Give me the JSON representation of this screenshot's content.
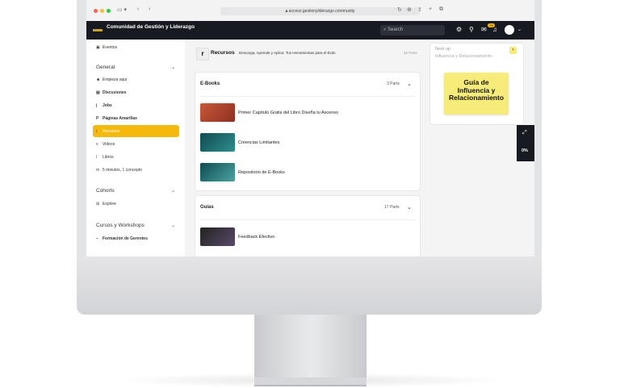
{
  "browser": {
    "url": "acceso.gestionyliderazgo.community",
    "traffic_lights": [
      "#ff5f57",
      "#febc2e",
      "#28c840"
    ]
  },
  "header": {
    "community_name": "Comunidad de Gestión y Liderazgo",
    "search_placeholder": "Search",
    "notification_badge": "+9"
  },
  "sidebar": {
    "top_item": "Eventos",
    "general_heading": "General",
    "general_items": [
      {
        "label": "Empieza aquí",
        "icon": "person-icon"
      },
      {
        "label": "Discusiones",
        "icon": "chat-icon"
      },
      {
        "label": "Jobs",
        "icon": "j"
      },
      {
        "label": "Páginas Amarillas",
        "icon": "P"
      },
      {
        "label": "Recursos",
        "icon": "r"
      },
      {
        "label": "Videos",
        "icon": "v"
      },
      {
        "label": "Libros",
        "icon": "l"
      },
      {
        "label": "5 minutos, 1 concepto",
        "icon": "m"
      }
    ],
    "cohorts_heading": "Cohorts",
    "cohorts_items": [
      {
        "label": "Explore",
        "icon": "grid-icon"
      }
    ],
    "cursos_heading": "Cursos y Workshops",
    "cursos_items": [
      {
        "label": "Formación de Gerentes",
        "icon": "dash"
      }
    ]
  },
  "main": {
    "title": "Recursos",
    "subtitle": "Descarga, Aprende y Aplica: Tus Herramientas para el Éxito",
    "parts": "32 Parts",
    "sections": [
      {
        "title": "E-Books",
        "parts": "3 Parts",
        "items": [
          {
            "label": "Primer Capítulo Gratis del Libro Diseña tu Ascenso"
          },
          {
            "label": "Creencias Limitantes"
          },
          {
            "label": "Repositorio de E-Books"
          }
        ]
      },
      {
        "title": "Guías",
        "parts": "17 Parts",
        "items": [
          {
            "label": "Feedback Efectivo"
          }
        ]
      }
    ]
  },
  "right_panel": {
    "next_up": "Next up",
    "next_title": "Influencia y Relacionamiento",
    "card_text": "Guía de Influencia y Relacionamiento"
  },
  "progress": {
    "value": "0%"
  },
  "colors": {
    "accent": "#f5b90e",
    "header_bg": "#171a21",
    "sticky": "#f7ec7a"
  }
}
